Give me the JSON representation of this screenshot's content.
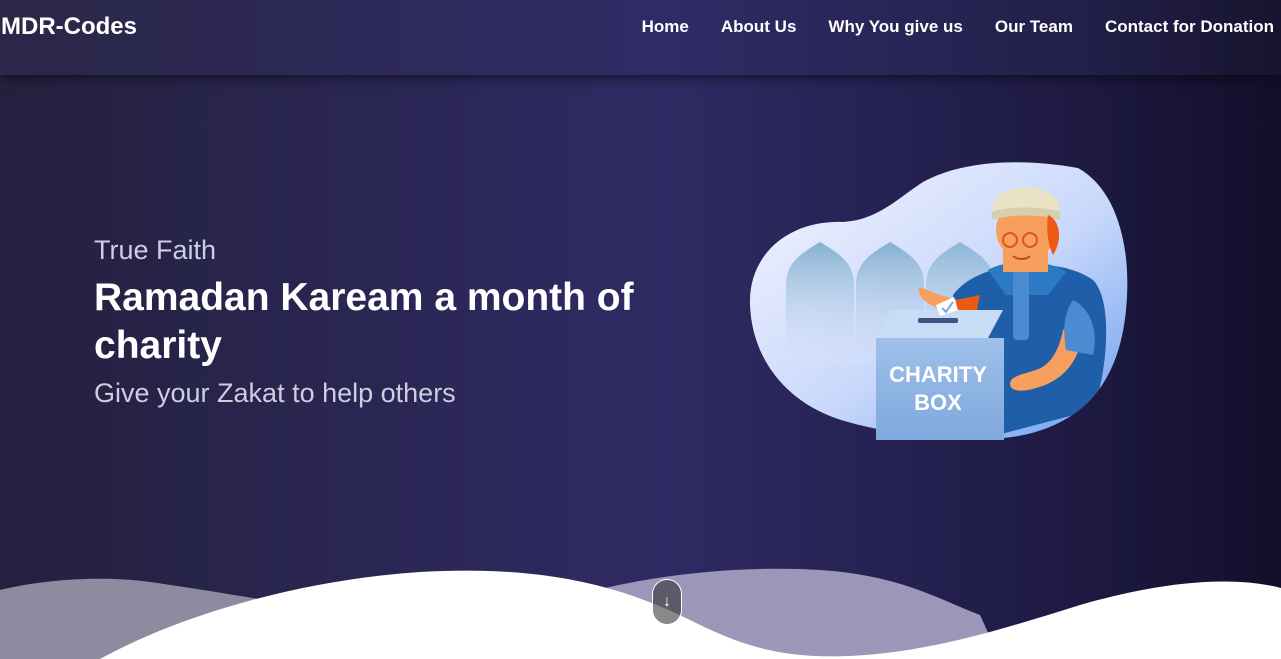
{
  "brand": "MDR-Codes",
  "nav": {
    "home": "Home",
    "about": "About Us",
    "why": "Why You give us",
    "team": "Our Team",
    "contact": "Contact for Donation"
  },
  "hero": {
    "eyebrow": "True Faith",
    "headline": "Ramadan Kaream a month of charity",
    "subline": "Give your Zakat to help others"
  },
  "illustration": {
    "box_line1": "CHARITY",
    "box_line2": "BOX"
  },
  "scroll": {
    "icon": "arrow-down-icon",
    "glyph": "↓"
  },
  "colors": {
    "bg_dark": "#24213f",
    "bg_mid": "#2f2a63",
    "wave_gray": "#8e8ba0",
    "wave_white": "#ffffff",
    "accent_blue": "#1f5ea8",
    "skin": "#f7a05e"
  }
}
